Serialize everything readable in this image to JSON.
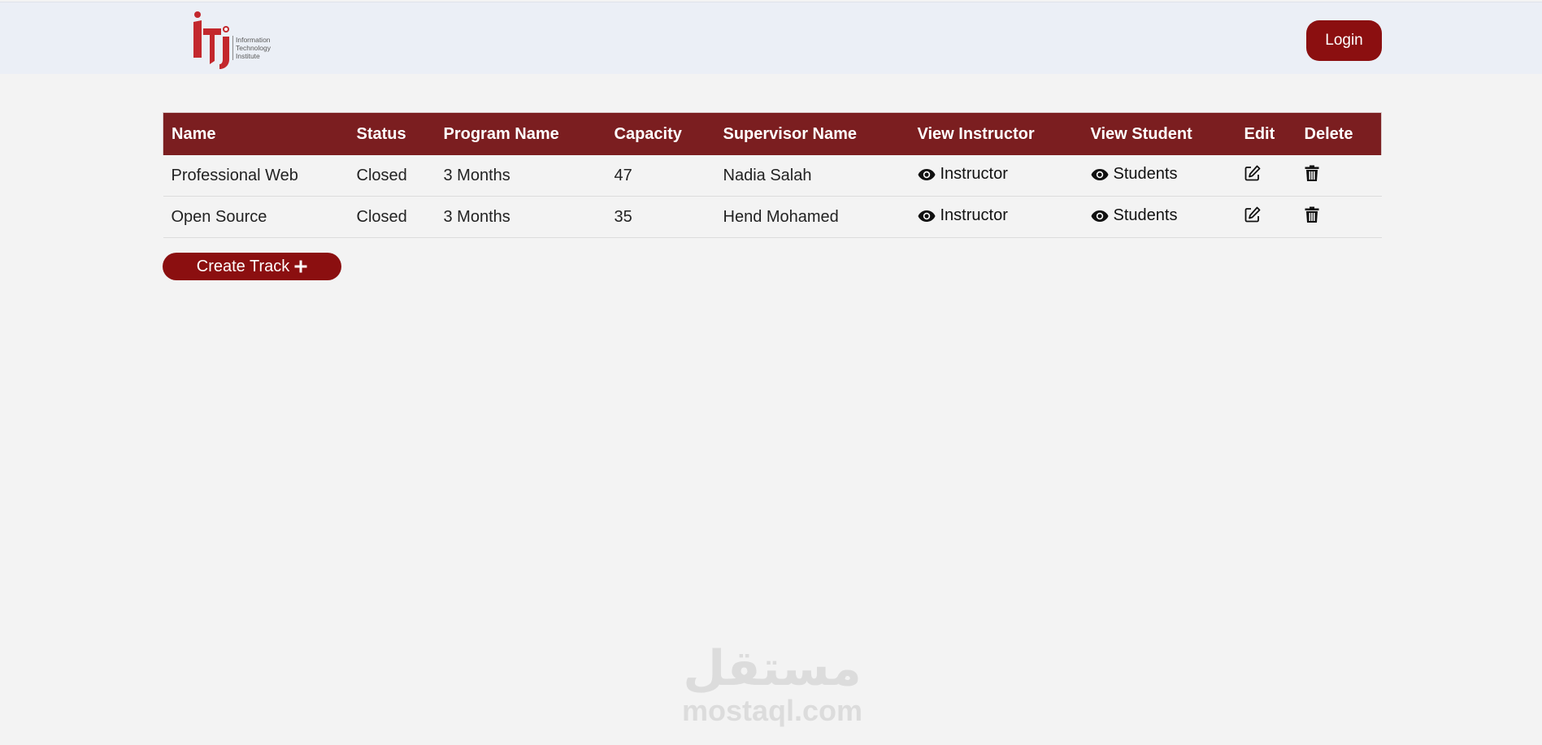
{
  "header": {
    "logo_lines": [
      "Information",
      "Technology",
      "Institute"
    ],
    "login_label": "Login"
  },
  "table": {
    "columns": [
      "Name",
      "Status",
      "Program Name",
      "Capacity",
      "Supervisor Name",
      "View Instructor",
      "View Student",
      "Edit",
      "Delete"
    ],
    "rows": [
      {
        "name": "Professional Web",
        "status": "Closed",
        "program": "3 Months",
        "capacity": "47",
        "supervisor": "Nadia Salah",
        "instructor_link": "Instructor",
        "students_link": "Students"
      },
      {
        "name": "Open Source",
        "status": "Closed",
        "program": "3 Months",
        "capacity": "35",
        "supervisor": "Hend Mohamed",
        "instructor_link": "Instructor",
        "students_link": "Students"
      }
    ]
  },
  "create_button_label": "Create Track",
  "watermark": {
    "arabic": "مستقل",
    "latin": "mostaql.com"
  },
  "icons": {
    "view": "eye-icon",
    "edit": "edit-icon",
    "delete": "trash-icon",
    "create": "plus-icon"
  },
  "colors": {
    "brand": "#8b0f10",
    "table_header": "#7b1e20",
    "header_bg": "#ebeff6",
    "page_bg": "#f3f3f3"
  }
}
